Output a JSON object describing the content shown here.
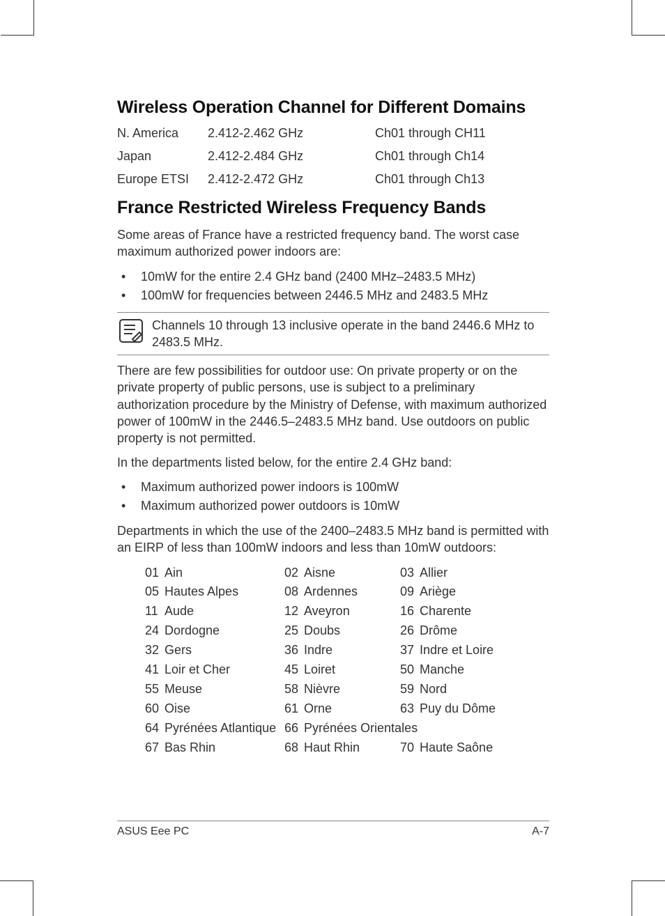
{
  "heading1": "Wireless Operation Channel for Different Domains",
  "domains": [
    {
      "region": "N. America",
      "freq": "2.412-2.462 GHz",
      "ch": "Ch01 through CH11"
    },
    {
      "region": "Japan",
      "freq": "2.412-2.484 GHz",
      "ch": "Ch01 through Ch14"
    },
    {
      "region": "Europe ETSI",
      "freq": "2.412-2.472 GHz",
      "ch": "Ch01 through Ch13"
    }
  ],
  "heading2": "France Restricted Wireless Frequency Bands",
  "para1": "Some areas of France have a restricted frequency band. The worst case maximum authorized power indoors are:",
  "bullets1": [
    "10mW for the entire 2.4 GHz band (2400 MHz–2483.5 MHz)",
    "100mW for frequencies between 2446.5 MHz and 2483.5 MHz"
  ],
  "note": "Channels 10 through 13 inclusive operate in the band 2446.6 MHz to 2483.5 MHz.",
  "para2": "There are few possibilities for outdoor use: On private property or on the private property of public persons, use is subject to a preliminary authorization procedure by the Ministry of Defense, with maximum authorized power of 100mW in the 2446.5–2483.5 MHz band. Use outdoors on public property is not permitted.",
  "para3": "In the departments listed below, for the entire 2.4 GHz band:",
  "bullets2": [
    "Maximum authorized power indoors is 100mW",
    "Maximum authorized power outdoors is 10mW"
  ],
  "para4": "Departments in which the use of the 2400–2483.5 MHz band is permitted with an EIRP of less than 100mW indoors and less than 10mW outdoors:",
  "departments": [
    [
      {
        "n": "01",
        "name": "Ain"
      },
      {
        "n": "02",
        "name": "Aisne"
      },
      {
        "n": "03",
        "name": "Allier"
      }
    ],
    [
      {
        "n": "05",
        "name": "Hautes Alpes"
      },
      {
        "n": "08",
        "name": "Ardennes"
      },
      {
        "n": "09",
        "name": "Ariège"
      }
    ],
    [
      {
        "n": "11",
        "name": "Aude"
      },
      {
        "n": "12",
        "name": "Aveyron"
      },
      {
        "n": "16",
        "name": "Charente"
      }
    ],
    [
      {
        "n": "24",
        "name": "Dordogne"
      },
      {
        "n": "25",
        "name": "Doubs"
      },
      {
        "n": "26",
        "name": "Drôme"
      }
    ],
    [
      {
        "n": "32",
        "name": "Gers"
      },
      {
        "n": "36",
        "name": "Indre"
      },
      {
        "n": "37",
        "name": "Indre et Loire"
      }
    ],
    [
      {
        "n": "41",
        "name": "Loir et Cher"
      },
      {
        "n": "45",
        "name": "Loiret"
      },
      {
        "n": "50",
        "name": "Manche"
      }
    ],
    [
      {
        "n": "55",
        "name": "Meuse"
      },
      {
        "n": "58",
        "name": "Nièvre"
      },
      {
        "n": "59",
        "name": "Nord"
      }
    ],
    [
      {
        "n": "60",
        "name": "Oise"
      },
      {
        "n": "61",
        "name": "Orne"
      },
      {
        "n": "63",
        "name": "Puy du Dôme"
      }
    ],
    [
      {
        "n": "64",
        "name": "Pyrénées Atlantique"
      },
      {
        "n": "66",
        "name": "Pyrénées Orientales"
      }
    ],
    [
      {
        "n": "67",
        "name": "Bas Rhin"
      },
      {
        "n": "68",
        "name": "Haut Rhin"
      },
      {
        "n": "70",
        "name": "Haute Saône"
      }
    ]
  ],
  "footer": {
    "left": "ASUS Eee PC",
    "right": "A-7"
  }
}
